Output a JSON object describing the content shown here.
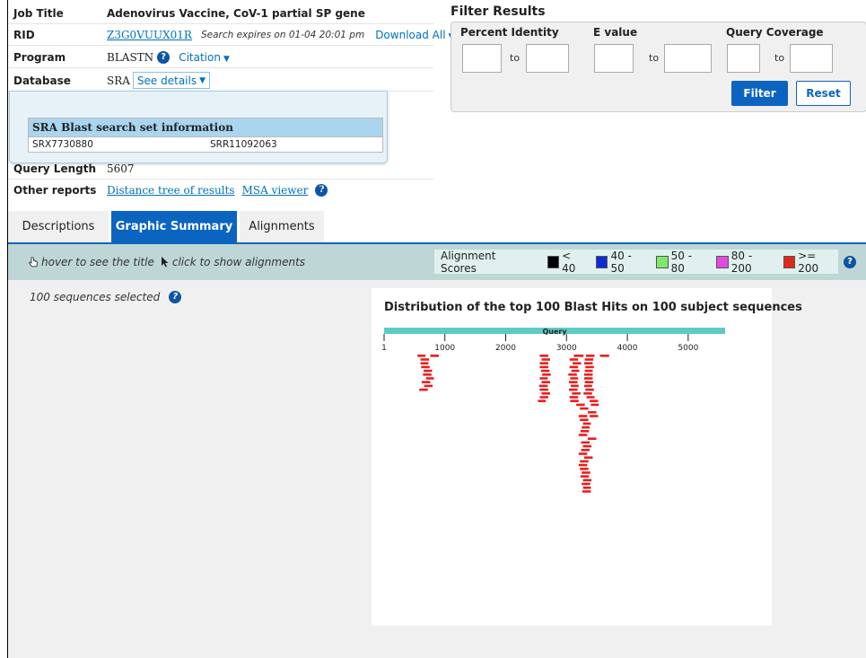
{
  "job": {
    "job_title_label": "Job Title",
    "job_title": "Adenovirus Vaccine, CoV-1 partial SP gene",
    "rid_label": "RID",
    "rid": "Z3G0VUUX01R",
    "expires": "Search expires on 01-04 20:01 pm",
    "download": "Download All",
    "program_label": "Program",
    "program": "BLASTN",
    "citation": "Citation",
    "database_label": "Database",
    "database": "SRA",
    "see_details": "See details",
    "query_length_label": "Query Length",
    "query_length": "5607",
    "other_reports_label": "Other reports",
    "distance_tree": "Distance tree of results",
    "msa_viewer": "MSA viewer"
  },
  "popup": {
    "title": "SRA Blast search set information",
    "cells": [
      "SRX7730880",
      "SRR11092063"
    ]
  },
  "filter": {
    "title": "Filter Results",
    "percent_identity": "Percent Identity",
    "evalue": "E value",
    "query_coverage": "Query Coverage",
    "to": "to",
    "filter_button": "Filter",
    "reset_button": "Reset"
  },
  "tabs": [
    "Descriptions",
    "Graphic Summary",
    "Alignments"
  ],
  "toolbar": {
    "hover_hint": "hover to see the title",
    "click_hint": "click to show alignments",
    "scores_label": "Alignment Scores",
    "legend": [
      {
        "label": "< 40",
        "color": "#000000"
      },
      {
        "label": "40 - 50",
        "color": "#0a2ed6"
      },
      {
        "label": "50 - 80",
        "color": "#7ee86c"
      },
      {
        "label": "80 - 200",
        "color": "#e04ae0"
      },
      {
        "label": ">= 200",
        "color": "#dd2a1b"
      }
    ]
  },
  "main": {
    "sequences_selected": "100 sequences selected"
  },
  "graphic": {
    "title": "Distribution of the top 100 Blast Hits on 100 subject sequences",
    "query_label": "Query",
    "query_length": 5607,
    "ticks": [
      1,
      1000,
      2000,
      3000,
      4000,
      5000
    ],
    "hit_color": "#ee1c1c",
    "hits": [
      {
        "start": 550,
        "end": 680
      },
      {
        "start": 760,
        "end": 900
      },
      {
        "start": 3550,
        "end": 3700
      },
      {
        "start": 600,
        "end": 740
      },
      {
        "start": 2560,
        "end": 2700
      },
      {
        "start": 3120,
        "end": 3280
      },
      {
        "start": 3300,
        "end": 3440
      },
      {
        "start": 600,
        "end": 730
      },
      {
        "start": 2590,
        "end": 2730
      },
      {
        "start": 3050,
        "end": 3190
      },
      {
        "start": 3290,
        "end": 3430
      },
      {
        "start": 610,
        "end": 750
      },
      {
        "start": 2560,
        "end": 2700
      },
      {
        "start": 3100,
        "end": 3240
      },
      {
        "start": 3310,
        "end": 3450
      },
      {
        "start": 650,
        "end": 790
      },
      {
        "start": 2560,
        "end": 2700
      },
      {
        "start": 3050,
        "end": 3190
      },
      {
        "start": 3300,
        "end": 3430
      },
      {
        "start": 640,
        "end": 780
      },
      {
        "start": 2580,
        "end": 2720
      },
      {
        "start": 3080,
        "end": 3210
      },
      {
        "start": 3290,
        "end": 3430
      },
      {
        "start": 690,
        "end": 820
      },
      {
        "start": 2600,
        "end": 2740
      },
      {
        "start": 3030,
        "end": 3170
      },
      {
        "start": 3290,
        "end": 3430
      },
      {
        "start": 620,
        "end": 760
      },
      {
        "start": 2560,
        "end": 2690
      },
      {
        "start": 3060,
        "end": 3190
      },
      {
        "start": 3300,
        "end": 3440
      },
      {
        "start": 660,
        "end": 800
      },
      {
        "start": 2590,
        "end": 2730
      },
      {
        "start": 3040,
        "end": 3180
      },
      {
        "start": 3320,
        "end": 3460
      },
      {
        "start": 580,
        "end": 720
      },
      {
        "start": 2550,
        "end": 2690
      },
      {
        "start": 3070,
        "end": 3200
      },
      {
        "start": 3290,
        "end": 3420
      },
      {
        "start": 2560,
        "end": 2700
      },
      {
        "start": 3040,
        "end": 3180
      },
      {
        "start": 3310,
        "end": 3450
      },
      {
        "start": 2590,
        "end": 2730
      },
      {
        "start": 3090,
        "end": 3230
      },
      {
        "start": 3280,
        "end": 3420
      },
      {
        "start": 2560,
        "end": 2700
      },
      {
        "start": 3050,
        "end": 3190
      },
      {
        "start": 3330,
        "end": 3460
      },
      {
        "start": 2530,
        "end": 2660
      },
      {
        "start": 3060,
        "end": 3200
      },
      {
        "start": 3380,
        "end": 3520
      },
      {
        "start": 3160,
        "end": 3300
      },
      {
        "start": 3400,
        "end": 3530
      },
      {
        "start": 3220,
        "end": 3360
      },
      {
        "start": 3350,
        "end": 3490
      },
      {
        "start": 3200,
        "end": 3340
      },
      {
        "start": 3220,
        "end": 3360
      },
      {
        "start": 3270,
        "end": 3400
      },
      {
        "start": 3250,
        "end": 3380
      },
      {
        "start": 3230,
        "end": 3370
      },
      {
        "start": 3200,
        "end": 3340
      },
      {
        "start": 3350,
        "end": 3490
      },
      {
        "start": 3240,
        "end": 3380
      },
      {
        "start": 3270,
        "end": 3410
      },
      {
        "start": 3240,
        "end": 3380
      },
      {
        "start": 3200,
        "end": 3340
      },
      {
        "start": 3380,
        "end": 3520
      },
      {
        "start": 3290,
        "end": 3430
      },
      {
        "start": 3220,
        "end": 3360
      },
      {
        "start": 3200,
        "end": 3340
      },
      {
        "start": 3220,
        "end": 3360
      },
      {
        "start": 3250,
        "end": 3390
      },
      {
        "start": 3230,
        "end": 3370
      },
      {
        "start": 3270,
        "end": 3410
      },
      {
        "start": 3250,
        "end": 3390
      },
      {
        "start": 3270,
        "end": 3400
      },
      {
        "start": 3260,
        "end": 3400
      }
    ]
  }
}
